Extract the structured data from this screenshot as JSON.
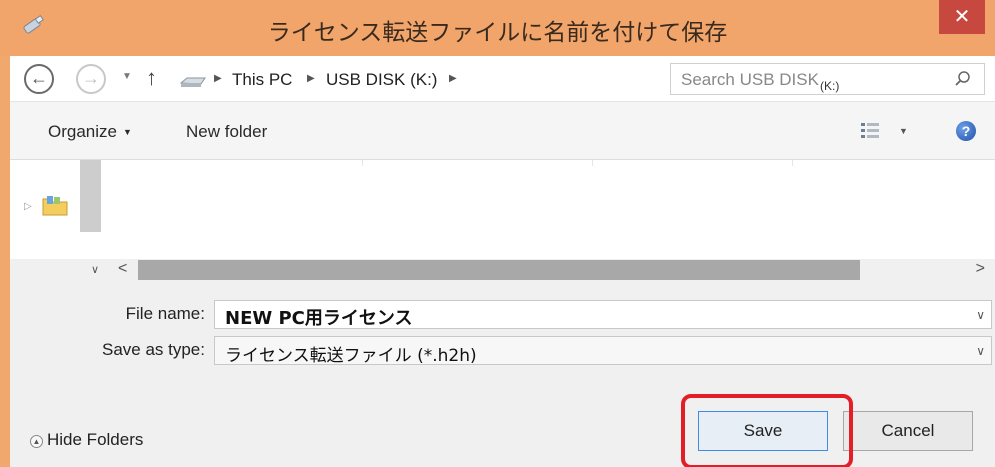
{
  "window": {
    "title": "ライセンス転送ファイルに名前を付けて保存",
    "close_label": "✕"
  },
  "address": {
    "crumbs": [
      "This PC",
      "USB DISK (K:)"
    ],
    "search_placeholder": "Search USB DISK",
    "search_placeholder_tail": "(K:)"
  },
  "toolbar": {
    "organize_label": "Organize",
    "new_folder_label": "New folder",
    "help_label": "?"
  },
  "form": {
    "file_name_label": "File name:",
    "file_name_value": "NEW PC用ライセンス",
    "save_type_label": "Save as type:",
    "save_type_value": "ライセンス転送ファイル (*.h2h)"
  },
  "footer": {
    "hide_folders_label": "Hide Folders",
    "save_label": "Save",
    "cancel_label": "Cancel"
  },
  "colors": {
    "titlebar": "#f1a56b",
    "close": "#c7483f",
    "highlight": "#e41e26",
    "save_border": "#3d8ee3"
  }
}
